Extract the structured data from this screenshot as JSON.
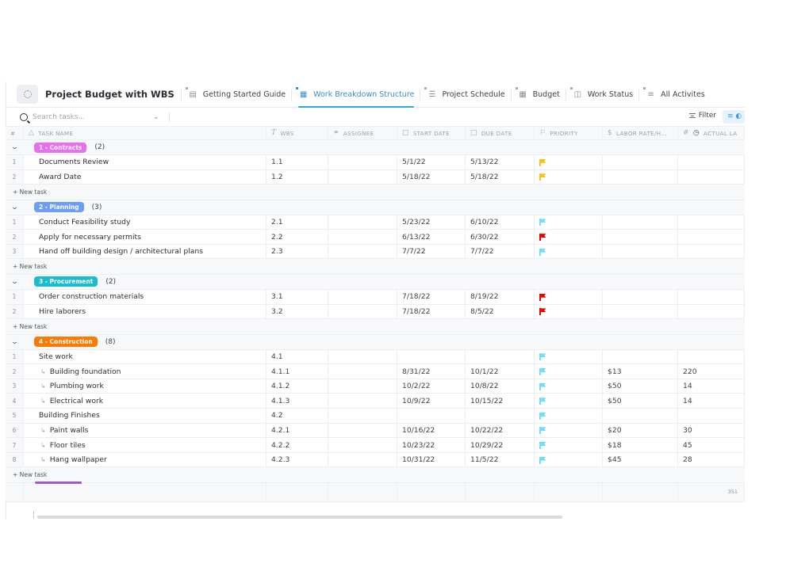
{
  "header": {
    "space_icon": "dotted-circle-icon",
    "project_title": "Project Budget with WBS",
    "tabs": [
      {
        "label": "Getting Started Guide",
        "icon": "doc-icon",
        "active": false
      },
      {
        "label": "Work Breakdown Structure",
        "icon": "table-icon",
        "active": true
      },
      {
        "label": "Project Schedule",
        "icon": "gantt-icon",
        "active": false
      },
      {
        "label": "Budget",
        "icon": "table-icon",
        "active": false
      },
      {
        "label": "Work Status",
        "icon": "board-icon",
        "active": false
      },
      {
        "label": "All Activites",
        "icon": "list-icon",
        "active": false
      }
    ]
  },
  "toolbar": {
    "search_placeholder": "Search tasks...",
    "filter_label": "Filter",
    "group_icon": "layers-icon"
  },
  "columns": {
    "num": "#",
    "task_name": "TASK NAME",
    "wbs": "WBS",
    "assignee": "ASSIGNEE",
    "start_date": "START DATE",
    "due_date": "DUE DATE",
    "priority": "PRIORITY",
    "labor_rate": "LABOR RATE/H...",
    "actual_labor": "ACTUAL LA"
  },
  "priority_colors": {
    "normal": "#f8c21b",
    "low": "#6fddff",
    "urgent": "#f50000"
  },
  "new_task_label": "+ New task",
  "groups": [
    {
      "name": "1 - Contracts",
      "count": "(2)",
      "color": "#e86ff0",
      "tasks": [
        {
          "num": "1",
          "name": "Documents Review",
          "sub": false,
          "wbs": "1.1",
          "assignee": "",
          "start": "5/1/22",
          "due": "5/13/22",
          "priority": "normal",
          "rate": "",
          "actual": ""
        },
        {
          "num": "2",
          "name": "Award Date",
          "sub": false,
          "wbs": "1.2",
          "assignee": "",
          "start": "5/18/22",
          "due": "5/18/22",
          "priority": "normal",
          "rate": "",
          "actual": ""
        }
      ]
    },
    {
      "name": "2 - Planning",
      "count": "(3)",
      "color": "#6c9ef8",
      "tasks": [
        {
          "num": "1",
          "name": "Conduct Feasibility study",
          "sub": false,
          "wbs": "2.1",
          "assignee": "",
          "start": "5/23/22",
          "due": "6/10/22",
          "priority": "low",
          "rate": "",
          "actual": ""
        },
        {
          "num": "2",
          "name": "Apply for necessary permits",
          "sub": false,
          "wbs": "2.2",
          "assignee": "",
          "start": "6/13/22",
          "due": "6/30/22",
          "priority": "urgent",
          "rate": "",
          "actual": ""
        },
        {
          "num": "3",
          "name": "Hand off building design / architectural plans",
          "sub": false,
          "wbs": "2.3",
          "assignee": "",
          "start": "7/7/22",
          "due": "7/7/22",
          "priority": "low",
          "rate": "",
          "actual": ""
        }
      ]
    },
    {
      "name": "3 - Procurement",
      "count": "(2)",
      "color": "#1bbcd0",
      "tasks": [
        {
          "num": "1",
          "name": "Order construction materials",
          "sub": false,
          "wbs": "3.1",
          "assignee": "",
          "start": "7/18/22",
          "due": "8/19/22",
          "priority": "urgent",
          "rate": "",
          "actual": ""
        },
        {
          "num": "2",
          "name": "Hire laborers",
          "sub": false,
          "wbs": "3.2",
          "assignee": "",
          "start": "7/18/22",
          "due": "8/5/22",
          "priority": "urgent",
          "rate": "",
          "actual": ""
        }
      ]
    },
    {
      "name": "4 - Construction",
      "count": "(8)",
      "color": "#ff7800",
      "tasks": [
        {
          "num": "1",
          "name": "Site work",
          "sub": false,
          "wbs": "4.1",
          "assignee": "",
          "start": "",
          "due": "",
          "priority": "low",
          "rate": "",
          "actual": ""
        },
        {
          "num": "2",
          "name": "Building foundation",
          "sub": true,
          "wbs": "4.1.1",
          "assignee": "",
          "start": "8/31/22",
          "due": "10/1/22",
          "priority": "low",
          "rate": "$13",
          "actual": "220"
        },
        {
          "num": "3",
          "name": "Plumbing work",
          "sub": true,
          "wbs": "4.1.2",
          "assignee": "",
          "start": "10/2/22",
          "due": "10/8/22",
          "priority": "low",
          "rate": "$50",
          "actual": "14"
        },
        {
          "num": "4",
          "name": "Electrical work",
          "sub": true,
          "wbs": "4.1.3",
          "assignee": "",
          "start": "10/9/22",
          "due": "10/15/22",
          "priority": "low",
          "rate": "$50",
          "actual": "14"
        },
        {
          "num": "5",
          "name": "Building Finishes",
          "sub": false,
          "wbs": "4.2",
          "assignee": "",
          "start": "",
          "due": "",
          "priority": "low",
          "rate": "",
          "actual": ""
        },
        {
          "num": "6",
          "name": "Paint walls",
          "sub": true,
          "wbs": "4.2.1",
          "assignee": "",
          "start": "10/16/22",
          "due": "10/22/22",
          "priority": "low",
          "rate": "$20",
          "actual": "30"
        },
        {
          "num": "7",
          "name": "Floor tiles",
          "sub": true,
          "wbs": "4.2.2",
          "assignee": "",
          "start": "10/23/22",
          "due": "10/29/22",
          "priority": "low",
          "rate": "$18",
          "actual": "45"
        },
        {
          "num": "8",
          "name": "Hang wallpaper",
          "sub": true,
          "wbs": "4.2.3",
          "assignee": "",
          "start": "10/31/22",
          "due": "11/5/22",
          "priority": "low",
          "rate": "$45",
          "actual": "28"
        }
      ]
    }
  ],
  "footer": {
    "actual_labor_total": "351"
  }
}
